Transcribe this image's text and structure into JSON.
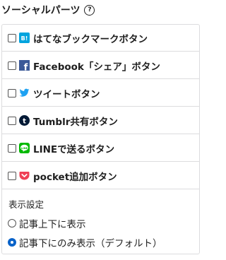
{
  "section": {
    "title": "ソーシャルパーツ",
    "help_icon": "?"
  },
  "share_buttons": [
    {
      "label": "はてなブックマークボタン",
      "icon": "hatena-bookmark-icon",
      "icon_text": "B!",
      "color": "#00a4de",
      "checked": false
    },
    {
      "label": "Facebook「シェア」ボタン",
      "icon": "facebook-icon",
      "icon_text": "f",
      "color": "#3b5998",
      "checked": false
    },
    {
      "label": "ツイートボタン",
      "icon": "twitter-icon",
      "color": "#1da1f2",
      "checked": false
    },
    {
      "label": "Tumblr共有ボタン",
      "icon": "tumblr-icon",
      "icon_text": "t",
      "color": "#001935",
      "checked": false
    },
    {
      "label": "LINEで送るボタン",
      "icon": "line-icon",
      "icon_text": "LINE",
      "color": "#00b900",
      "checked": false
    },
    {
      "label": "pocket追加ボタン",
      "icon": "pocket-icon",
      "color": "#ef4056",
      "checked": false
    }
  ],
  "display_settings": {
    "label": "表示設定",
    "options": [
      {
        "label": "記事上下に表示",
        "checked": false
      },
      {
        "label": "記事下にのみ表示（デフォルト）",
        "checked": true
      }
    ]
  },
  "colors": {
    "accent": "#0a63c9",
    "border": "#dcdcde"
  }
}
